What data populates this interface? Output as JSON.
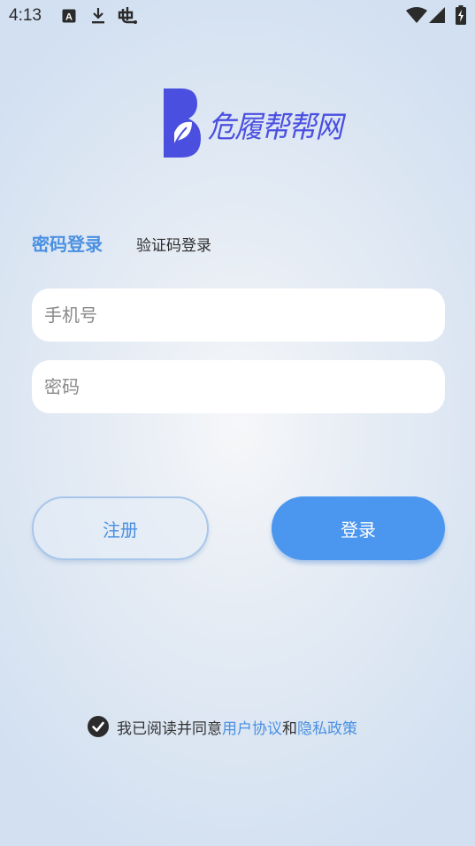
{
  "status_bar": {
    "time": "4:13",
    "icons": [
      "keyboard-a-icon",
      "download-icon",
      "debug-icon",
      "wifi-icon",
      "signal-icon",
      "battery-charging-icon"
    ]
  },
  "logo": {
    "text": "危履帮帮网",
    "icon": "b-leaf-logo-icon",
    "color": "#4a4fe0"
  },
  "tabs": [
    {
      "label": "密码登录",
      "active": true
    },
    {
      "label": "验证码登录",
      "active": false
    }
  ],
  "form": {
    "phone_placeholder": "手机号",
    "password_placeholder": "密码"
  },
  "buttons": {
    "register": "注册",
    "login": "登录"
  },
  "agreement": {
    "prefix": "我已阅读并同意",
    "user_agreement": "用户协议",
    "and": "和",
    "privacy_policy": "隐私政策",
    "checked": true
  },
  "colors": {
    "accent": "#4a90e2",
    "login_button": "#4b96ee",
    "logo": "#4a4fe0"
  }
}
